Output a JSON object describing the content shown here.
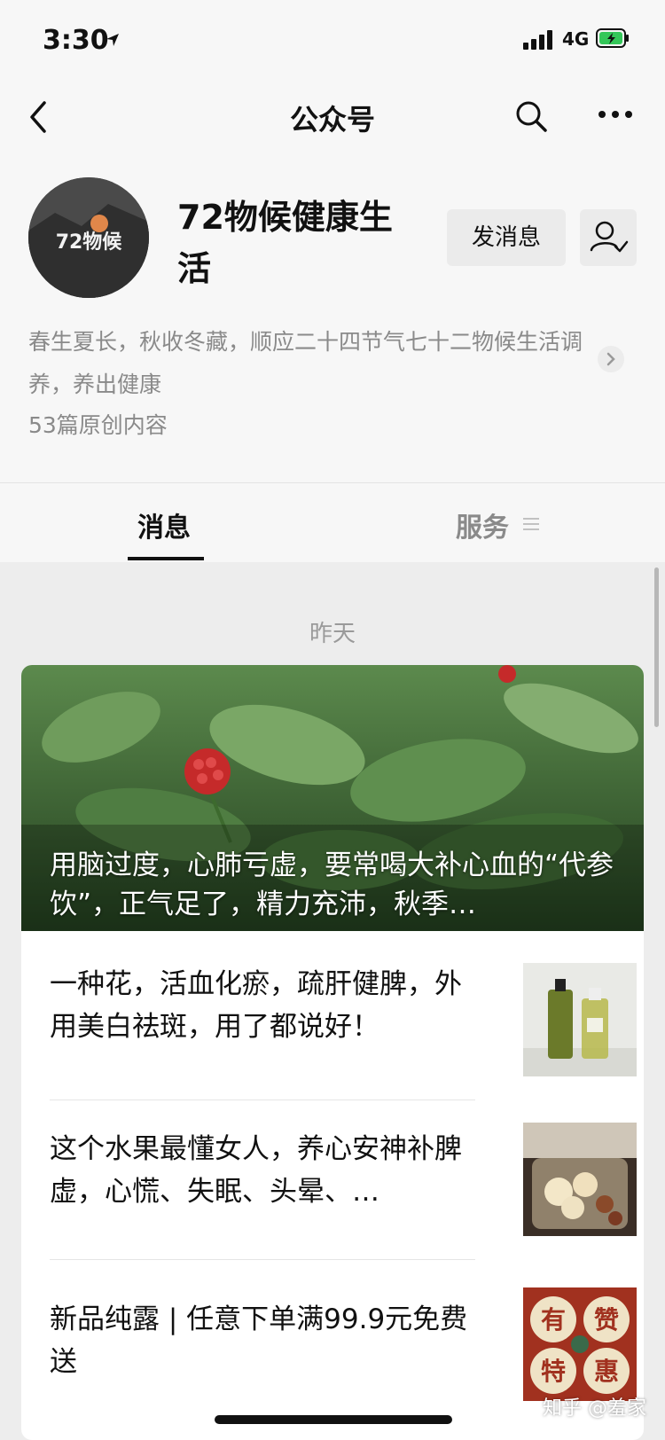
{
  "status_bar": {
    "time": "3:30",
    "network": "4G"
  },
  "nav": {
    "title": "公众号"
  },
  "account": {
    "name": "72物候健康生活",
    "avatar_text": "72物候",
    "message_button": "发消息",
    "description": "春生夏长，秋收冬藏，顺应二十四节气七十二物候生活调养，养出健康",
    "original_count": "53篇原创内容"
  },
  "tabs": {
    "messages": "消息",
    "services": "服务"
  },
  "feed": {
    "date": "昨天",
    "hero_title": "用脑过度，心肺亏虚，要常喝大补心血的“代参饮”，正气足了，精力充沛，秋季…",
    "articles": [
      {
        "title": "一种花，活血化瘀，疏肝健脾，外用美白祛斑，用了都说好！"
      },
      {
        "title": "这个水果最懂女人，养心安神补脾虚，心慌、失眠、头晕、…"
      },
      {
        "title": "新品纯露 | 任意下单满99.9元免费送",
        "thumb_chars": [
          "有",
          "赞",
          "特",
          "惠"
        ]
      }
    ]
  },
  "watermark": "知乎 @羞家",
  "colors": {
    "background": "#ededed",
    "header_bg": "#f7f7f7",
    "card_bg": "#ffffff",
    "hero_overlay": "#2f5a2a",
    "thumb_red": "#a1311f"
  }
}
